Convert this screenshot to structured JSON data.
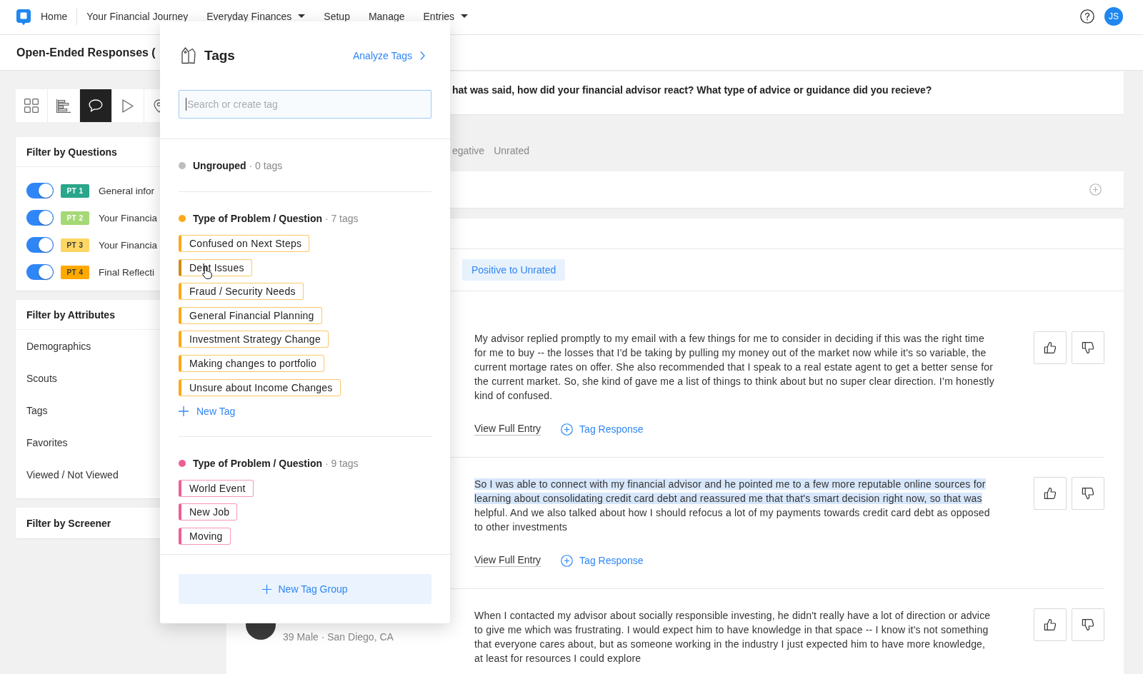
{
  "nav": {
    "home": "Home",
    "items": [
      {
        "label": "Your Financial Journey",
        "dropdown": false
      },
      {
        "label": "Everyday Finances",
        "dropdown": true
      },
      {
        "label": "Setup",
        "dropdown": false
      },
      {
        "label": "Manage",
        "dropdown": false
      },
      {
        "label": "Entries",
        "dropdown": true
      }
    ],
    "user_initials": "JS"
  },
  "page_title": "Open-Ended Responses (",
  "view_tools": [
    {
      "kind": "grid",
      "selected": false
    },
    {
      "kind": "bars",
      "selected": false
    },
    {
      "kind": "chat",
      "selected": true
    },
    {
      "kind": "play",
      "selected": false
    },
    {
      "kind": "pin",
      "selected": false
    }
  ],
  "filter_questions": {
    "title": "Filter by Questions",
    "items": [
      {
        "badge": "PT 1",
        "color": "#2aa68a",
        "label": "General infor",
        "on": true
      },
      {
        "badge": "PT 2",
        "color": "#a5d877",
        "label": "Your Financia",
        "on": true
      },
      {
        "badge": "PT 3",
        "color": "#fdd663",
        "label": "Your Financia",
        "on": true
      },
      {
        "badge": "PT 4",
        "color": "#ffa900",
        "label": "Final Reflecti",
        "on": true
      }
    ]
  },
  "filter_attributes": {
    "title": "Filter by Attributes",
    "items": [
      "Demographics",
      "Scouts",
      "Tags",
      "Favorites",
      "Viewed / Not Viewed"
    ]
  },
  "filter_screener": {
    "title": "Filter by Screener"
  },
  "question": "hat was said, how did your financial advisor react? What type of advice or guidance did you recieve?",
  "rating_tabs": [
    {
      "label": "egative",
      "selected": false
    },
    {
      "label": "Unrated",
      "selected": false
    }
  ],
  "active_filter": "Positive to Unrated",
  "responses": [
    {
      "text_parts": [
        {
          "text": "My advisor replied promptly to my email with a few things for me to consider in deciding if this was the right time for me to buy -- the losses that I'd be taking by pulling my money out of the market now while it's so variable, the current mortage rates on offer. She also recommended that I speak to a real estate agent to get a better sense for the current market. So, she kind of gave me a list of things to think about but no super clear direction. I’m honestly kind of confused.",
          "selected": false
        }
      ],
      "view_link": "View Full Entry",
      "tag_link": "Tag Response"
    },
    {
      "text_parts": [
        {
          "text": "So I was able to connect with my financial advisor and he pointed me to a few more reputable online sources for learning about consolidating credit card debt and reassured me that that's smart decision right now, so that was",
          "selected": true
        },
        {
          "text": " helpful. And we also talked about how I should refocus a lot of my payments towards credit card debt as opposed to other investments",
          "selected": false
        }
      ],
      "view_link": "View Full Entry",
      "tag_link": "Tag Response"
    },
    {
      "photo": true,
      "meta": "39 Male · San Diego, CA",
      "text_parts": [
        {
          "text": "When I contacted my advisor about socially responsible investing, he didn't really have a lot of direction or advice to give me which was frustrating. I would expect him to have knowledge in that space -- I know it's not something that everyone cares about, but as someone working in the industry I just expected him to have more knowledge, at least for resources I could explore",
          "selected": false
        }
      ]
    }
  ],
  "tags_popup": {
    "title": "Tags",
    "analyze_link": "Analyze Tags",
    "search": {
      "placeholder": "Search or create tag",
      "focused": true
    },
    "groups": [
      {
        "name": "Ungrouped",
        "count": "· 0 tags",
        "color": "#bdbdbd"
      },
      {
        "name": "Type of Problem / Question",
        "count": "· 7 tags",
        "color": "#fba919",
        "tags": [
          {
            "label": "Confused on Next Steps",
            "hovered": false
          },
          {
            "label": "Debt Issues",
            "hovered": true
          },
          {
            "label": "Fraud / Security Needs",
            "hovered": false
          },
          {
            "label": "General Financial Planning",
            "hovered": false
          },
          {
            "label": "Investment Strategy Change",
            "hovered": false
          },
          {
            "label": "Making changes to portfolio",
            "hovered": false
          },
          {
            "label": "Unsure about Income Changes",
            "hovered": false
          }
        ],
        "new_tag": "New Tag"
      },
      {
        "name": "Type of Problem / Question",
        "count": "· 9 tags",
        "color": "#ef5d95",
        "tags": [
          {
            "label": "World Event",
            "hovered": false
          },
          {
            "label": "New Job",
            "hovered": false
          },
          {
            "label": "Moving",
            "hovered": false
          }
        ]
      }
    ],
    "new_group": "New Tag Group"
  }
}
